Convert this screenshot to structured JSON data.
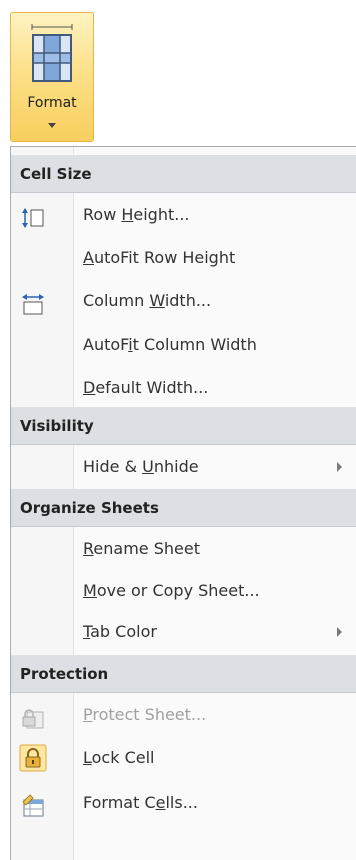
{
  "ribbon": {
    "format_label": "Format"
  },
  "menu": {
    "cell_size": {
      "header": "Cell Size",
      "row_height": {
        "pre": "Row ",
        "acc": "H",
        "post": "eight..."
      },
      "autofit_row_height": {
        "pre": "",
        "acc": "A",
        "post": "utoFit Row Height"
      },
      "column_width": {
        "pre": "Column ",
        "acc": "W",
        "post": "idth..."
      },
      "autofit_column_width": {
        "pre": "AutoF",
        "acc": "i",
        "post": "t Column Width"
      },
      "default_width": {
        "pre": "",
        "acc": "D",
        "post": "efault Width..."
      }
    },
    "visibility": {
      "header": "Visibility",
      "hide_unhide": {
        "pre": "Hide & ",
        "acc": "U",
        "post": "nhide"
      }
    },
    "organize_sheets": {
      "header": "Organize Sheets",
      "rename_sheet": {
        "pre": "",
        "acc": "R",
        "post": "ename Sheet"
      },
      "move_copy_sheet": {
        "pre": "",
        "acc": "M",
        "post": "ove or Copy Sheet..."
      },
      "tab_color": {
        "pre": "",
        "acc": "T",
        "post": "ab Color"
      }
    },
    "protection": {
      "header": "Protection",
      "protect_sheet": {
        "pre": "",
        "acc": "P",
        "post": "rotect Sheet..."
      },
      "lock_cell": {
        "pre": "",
        "acc": "L",
        "post": "ock Cell"
      },
      "format_cells": {
        "pre": "Format C",
        "acc": "e",
        "post": "lls..."
      }
    }
  }
}
